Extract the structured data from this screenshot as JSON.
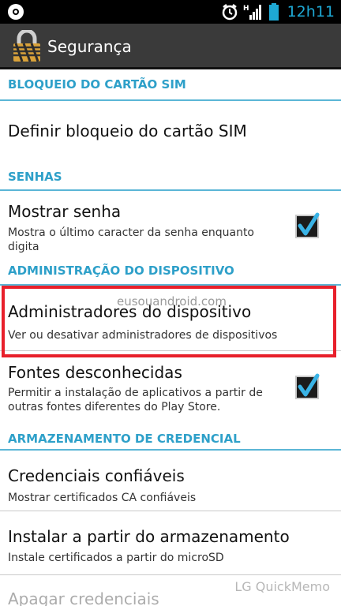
{
  "status_bar": {
    "time": "12h11",
    "network_badge": "H",
    "icons": [
      "app-notification-icon",
      "alarm-clock-icon",
      "signal-icon",
      "battery-icon"
    ]
  },
  "action_bar": {
    "title": "Segurança",
    "icon": "lock-icon"
  },
  "sections": [
    {
      "header": "BLOQUEIO DO CARTÃO SIM",
      "items": [
        {
          "title": "Definir bloqueio do cartão SIM"
        }
      ]
    },
    {
      "header": "SENHAS",
      "items": [
        {
          "title": "Mostrar senha",
          "subtitle": "Mostra o último caracter da senha enquanto digita",
          "checked": true
        }
      ]
    },
    {
      "header": "ADMINISTRAÇÃO DO DISPOSITIVO",
      "items": [
        {
          "title": "Administradores do dispositivo",
          "subtitle": "Ver ou desativar administradores de dispositivos"
        },
        {
          "title": "Fontes desconhecidas",
          "subtitle": "Permitir a instalação de aplicativos a partir de outras fontes diferentes do Play Store.",
          "checked": true,
          "highlighted": true
        }
      ]
    },
    {
      "header": "ARMAZENAMENTO DE CREDENCIAL",
      "items": [
        {
          "title": "Credenciais confiáveis",
          "subtitle": "Mostrar certificados CA confiáveis"
        },
        {
          "title": "Instalar a partir do armazenamento",
          "subtitle": "Instale certificados a partir do microSD"
        },
        {
          "title": "Apagar credenciais"
        }
      ]
    }
  ],
  "watermarks": {
    "site": "eusouandroid.com",
    "quickmemo": "LG QuickMemo"
  },
  "colors": {
    "accent": "#2ea0c9",
    "highlight": "#e8202b",
    "checkmark": "#39b3e6"
  }
}
